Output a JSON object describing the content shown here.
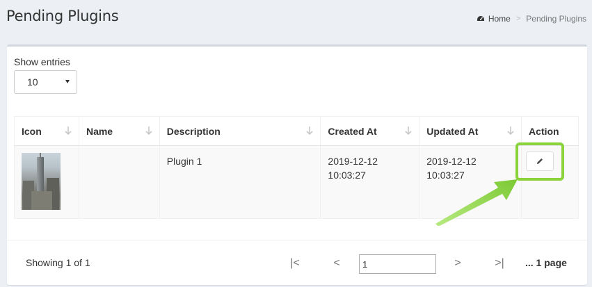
{
  "header": {
    "title": "Pending Plugins",
    "breadcrumb": {
      "home": "Home",
      "current": "Pending Plugins"
    }
  },
  "entries": {
    "label": "Show entries",
    "selected": "10"
  },
  "table": {
    "columns": [
      "Icon",
      "Name",
      "Description",
      "Created At",
      "Updated At",
      "Action"
    ],
    "rows": [
      {
        "icon": "empire-state-building-thumbnail",
        "name": "",
        "description": "Plugin 1",
        "created_at": "2019-12-12 10:03:27",
        "updated_at": "2019-12-12 10:03:27",
        "action": "edit-icon"
      }
    ]
  },
  "footer": {
    "showing": "Showing 1 of 1",
    "first": "|<",
    "prev": "<",
    "page_value": "1",
    "next": ">",
    "last": ">|",
    "page_count": "... 1 page"
  },
  "colors": {
    "highlight": "#8bd23b",
    "background": "#ecf0f5"
  }
}
